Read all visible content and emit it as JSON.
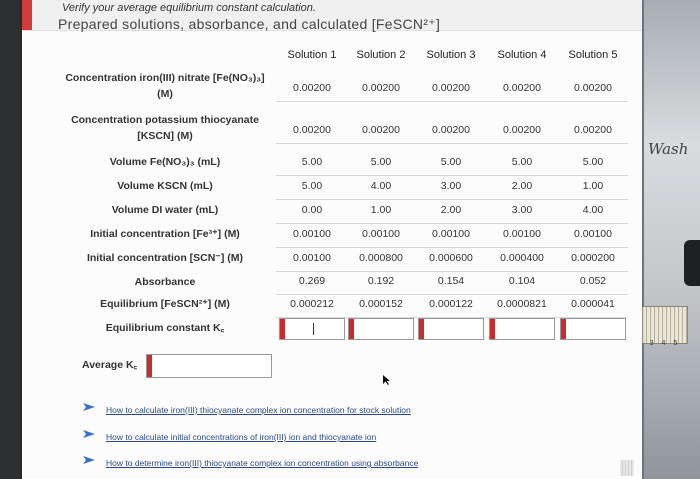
{
  "header": {
    "instruction": "Verify your average equilibrium constant calculation.",
    "title_fragment": "Prepared solutions, absorbance, and calculated [FeSCN²⁺]"
  },
  "columns": [
    "Solution 1",
    "Solution 2",
    "Solution 3",
    "Solution 4",
    "Solution 5"
  ],
  "rows": [
    {
      "label": "Concentration iron(III) nitrate [Fe(NO₃)₃] (M)",
      "values": [
        "0.00200",
        "0.00200",
        "0.00200",
        "0.00200",
        "0.00200"
      ]
    },
    {
      "label": "Concentration potassium thiocyanate [KSCN] (M)",
      "values": [
        "0.00200",
        "0.00200",
        "0.00200",
        "0.00200",
        "0.00200"
      ]
    },
    {
      "label": "Volume Fe(NO₃)₃ (mL)",
      "values": [
        "5.00",
        "5.00",
        "5.00",
        "5.00",
        "5.00"
      ]
    },
    {
      "label": "Volume KSCN (mL)",
      "values": [
        "5.00",
        "4.00",
        "3.00",
        "2.00",
        "1.00"
      ]
    },
    {
      "label": "Volume DI water (mL)",
      "values": [
        "0.00",
        "1.00",
        "2.00",
        "3.00",
        "4.00"
      ]
    },
    {
      "label": "Initial concentration [Fe³⁺] (M)",
      "values": [
        "0.00100",
        "0.00100",
        "0.00100",
        "0.00100",
        "0.00100"
      ]
    },
    {
      "label": "Initial concentration [SCN⁻] (M)",
      "values": [
        "0.00100",
        "0.000800",
        "0.000600",
        "0.000400",
        "0.000200"
      ]
    },
    {
      "label": "Absorbance",
      "values": [
        "0.269",
        "0.192",
        "0.154",
        "0.104",
        "0.052"
      ]
    },
    {
      "label": "Equilibrium [FeSCN²⁺] (M)",
      "values": [
        "0.000212",
        "0.000152",
        "0.000122",
        "0.0000821",
        "0.000041"
      ]
    },
    {
      "label": "Equilibrium constant K꜀",
      "values": [
        "",
        "",
        "",
        "",
        ""
      ]
    }
  ],
  "average": {
    "label": "Average K꜀",
    "value": ""
  },
  "links": [
    "How to calculate iron(III) thiocyanate complex ion concentration for stock solution",
    "How to calculate initial concentrations of iron(III) ion and thiocyanate ion",
    "How to determine iron(III) thiocyanate complex ion concentration using absorbance"
  ],
  "background": {
    "label_text": "Wash",
    "ruler_numbers": "1 2 3 4 5"
  },
  "colors": {
    "accent_red": "#cc2b2b",
    "link_blue": "#2b4a8c",
    "text": "#333333"
  }
}
